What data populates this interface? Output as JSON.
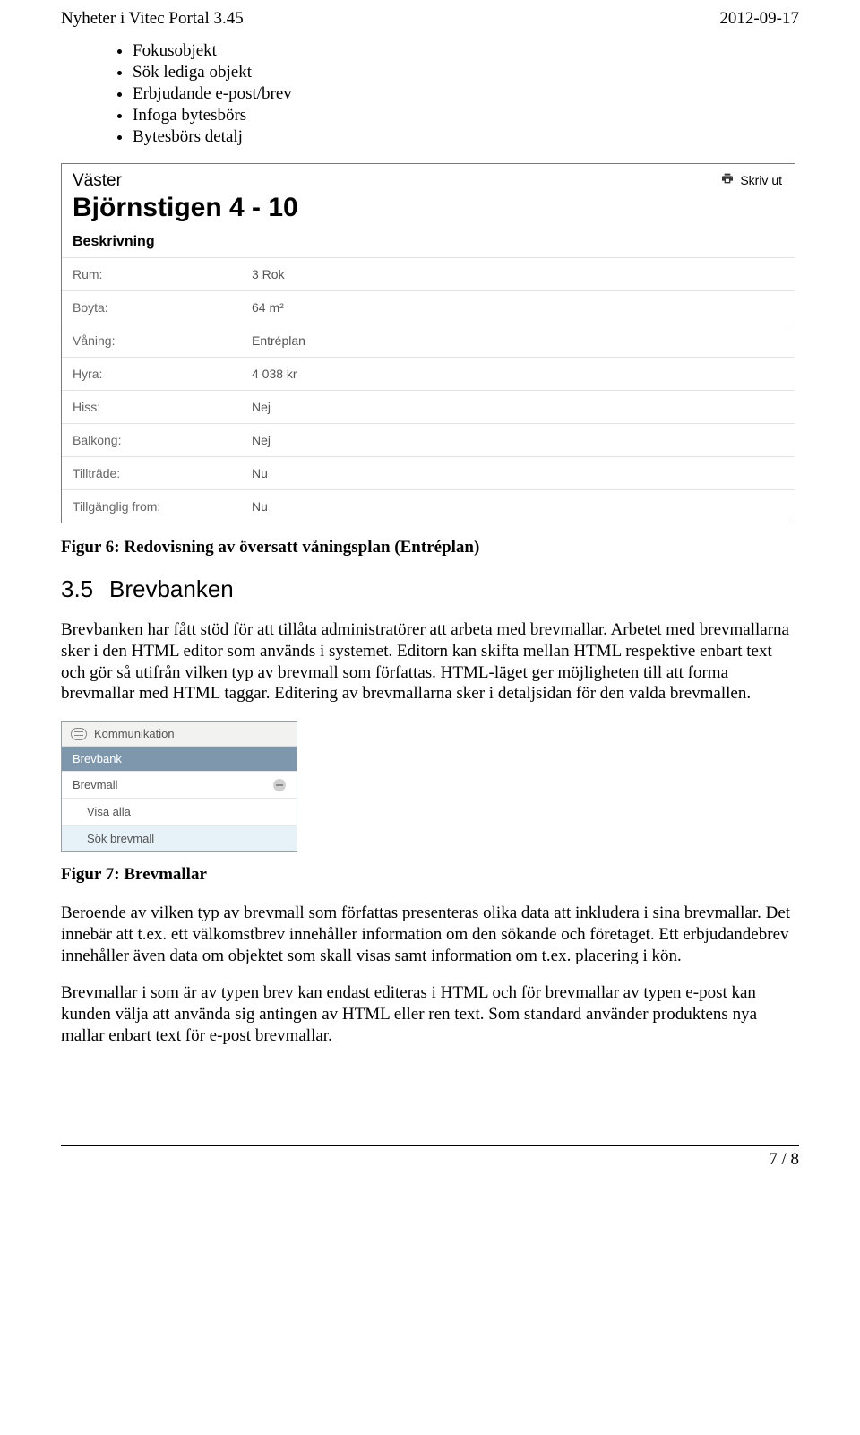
{
  "header": {
    "title": "Nyheter i Vitec Portal 3.45",
    "date": "2012-09-17"
  },
  "bullets": [
    "Fokusobjekt",
    "Sök lediga objekt",
    "Erbjudande e-post/brev",
    "Infoga bytesbörs",
    "Bytesbörs detalj"
  ],
  "panel": {
    "region": "Väster",
    "title": "Björnstigen 4 - 10",
    "subhead": "Beskrivning",
    "print": "Skriv ut",
    "rows": [
      {
        "k": "Rum:",
        "v": "3 Rok"
      },
      {
        "k": "Boyta:",
        "v": "64 m²"
      },
      {
        "k": "Våning:",
        "v": "Entréplan"
      },
      {
        "k": "Hyra:",
        "v": "4 038 kr"
      },
      {
        "k": "Hiss:",
        "v": "Nej"
      },
      {
        "k": "Balkong:",
        "v": "Nej"
      },
      {
        "k": "Tillträde:",
        "v": "Nu"
      },
      {
        "k": "Tillgänglig from:",
        "v": "Nu"
      }
    ]
  },
  "fig6_caption": "Figur 6: Redovisning av översatt våningsplan (Entréplan)",
  "section": {
    "num": "3.5",
    "title": "Brevbanken"
  },
  "para1": "Brevbanken har fått stöd för att tillåta administratörer att arbeta med brevmallar. Arbetet med brevmallarna sker i den HTML editor som används i systemet. Editorn kan skifta mellan HTML respektive enbart text och gör så utifrån vilken typ av brevmall som författas. HTML-läget ger möjligheten till att forma brevmallar med HTML taggar. Editering av brevmallarna sker i detaljsidan för den valda brevmallen.",
  "menu": {
    "head": "Kommunikation",
    "selected": "Brevbank",
    "item": "Brevmall",
    "sub1": "Visa alla",
    "sub2": "Sök brevmall"
  },
  "fig7_caption": "Figur 7: Brevmallar",
  "para2": "Beroende av vilken typ av brevmall som författas presenteras olika data att inkludera i sina brevmallar. Det innebär att t.ex. ett välkomstbrev innehåller information om den sökande och företaget. Ett erbjudandebrev innehåller även data om objektet som skall visas samt information om t.ex. placering i kön.",
  "para3": "Brevmallar i som är av typen brev kan endast editeras i HTML och för brevmallar av typen e-post kan kunden välja att använda sig antingen av HTML eller ren text. Som standard använder produktens nya mallar enbart text för e-post brevmallar.",
  "footer": "7 / 8"
}
